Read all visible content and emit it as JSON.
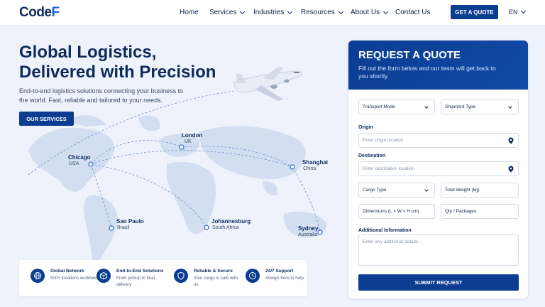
{
  "brand": {
    "logo_text": "Code",
    "logo_mark": "F"
  },
  "nav": {
    "items": [
      {
        "label": "Home"
      },
      {
        "label": "Services"
      },
      {
        "label": "Industries"
      },
      {
        "label": "Resources"
      },
      {
        "label": "About Us"
      },
      {
        "label": "Contact Us"
      }
    ],
    "cta_label": "GET A QUOTE",
    "language": "EN"
  },
  "hero": {
    "title_line1": "Global Logistics,",
    "title_line2": "Delivered with Precision",
    "subtitle": "End-to-end logistics solutions connecting your business to the world. Fast, reliable and tailored to your needs.",
    "button_label": "OUR SERVICES"
  },
  "map": {
    "cities": [
      {
        "name": "London",
        "country": "UK"
      },
      {
        "name": "Chicago",
        "country": "USA"
      },
      {
        "name": "Shanghai",
        "country": "China"
      },
      {
        "name": "Sao Paulo",
        "country": "Brazil"
      },
      {
        "name": "Johannesburg",
        "country": "South Africa"
      },
      {
        "name": "Sydney",
        "country": "Australia"
      }
    ]
  },
  "features": [
    {
      "title": "Global Network",
      "desc": "500+ locations worldwide",
      "icon": "globe-icon"
    },
    {
      "title": "End-to-End Solutions",
      "desc": "From pickup to final delivery",
      "icon": "package-icon"
    },
    {
      "title": "Reliable & Secure",
      "desc": "Your cargo is safe with us",
      "icon": "shield-icon"
    },
    {
      "title": "24/7 Support",
      "desc": "Always here to help",
      "icon": "clock-icon"
    }
  ],
  "quote_form": {
    "title": "REQUEST A QUOTE",
    "description": "Fill out the form below and our team will get back to you shortly.",
    "transport_mode": "Transport Mode",
    "shipment_type": "Shipment Type",
    "origin_label": "Origin",
    "origin_placeholder": "Enter origin location",
    "destination_label": "Destination",
    "destination_placeholder": "Enter destination location",
    "cargo_type": "Cargo Type",
    "total_weight": "Total Weight (kg)",
    "dimensions": "Dimensions (L × W × H cm)",
    "qty_packages": "Qty / Packages",
    "additional_label": "Additional Information",
    "additional_placeholder": "Enter any additional details...",
    "submit_label": "SUBMIT REQUEST"
  },
  "colors": {
    "primary": "#0b3d91",
    "accent": "#1e63d6",
    "background": "#eef3fb"
  }
}
